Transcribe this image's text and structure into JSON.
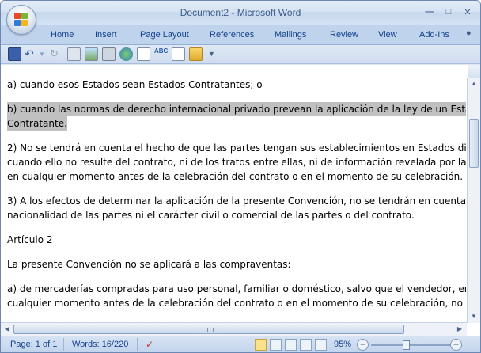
{
  "window": {
    "title_doc": "Document2",
    "title_sep": " - ",
    "title_app": "Microsoft Word"
  },
  "tabs": [
    "Home",
    "Insert",
    "Page Layout",
    "References",
    "Mailings",
    "Review",
    "View",
    "Add-Ins"
  ],
  "qat_icons": [
    "save-icon",
    "undo-icon",
    "redo-icon",
    "cut-icon",
    "picture-icon",
    "print-icon",
    "web-icon",
    "preview-icon",
    "spelling-icon",
    "new-icon",
    "open-icon",
    "customize-icon"
  ],
  "document": {
    "para1": "a) cuando esos Estados sean Estados Contratantes; o",
    "para2_l1": "b) cuando las normas de derecho internacional privado prevean la aplicación de la ley de un Estado",
    "para2_l2": "Contratante.",
    "para3_l1": "2) No se tendrá en cuenta el hecho de que las partes tengan sus establecimientos en Estados diferente",
    "para3_l2": "cuando ello no resulte del contrato, ni de los tratos entre ellas, ni de información revelada por las parte",
    "para3_l3": "en cualquier momento antes de la celebración del contrato o en el momento de su celebración.",
    "para4_l1": "3) A los efectos de determinar la aplicación de la presente Convención, no se tendrán en cuenta ni la",
    "para4_l2": "nacionalidad de las partes ni el carácter civil o comercial de las partes o del contrato.",
    "para5": "Artículo 2",
    "para6": "La presente Convención no se aplicará a las compraventas:",
    "para7_l1": "a) de mercaderías compradas para uso personal, familiar o doméstico, salvo que el vendedor, en",
    "para7_l2": "cualquier momento antes de la celebración del contrato o en el momento de su celebración, no hubier"
  },
  "status": {
    "page": "Page: 1 of 1",
    "words": "Words: 16/220",
    "zoom": "95%"
  }
}
